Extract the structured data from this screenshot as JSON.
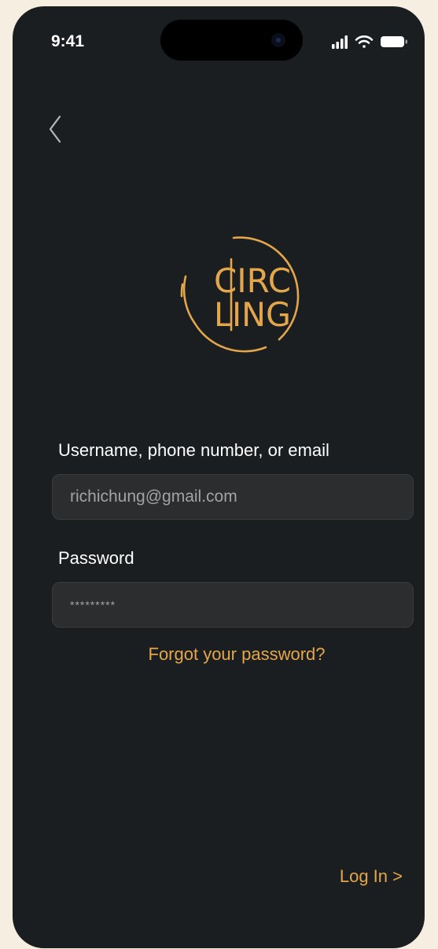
{
  "status_bar": {
    "time": "9:41",
    "icons": [
      "signal-icon",
      "wifi-icon",
      "battery-icon"
    ]
  },
  "nav": {
    "back_icon": "chevron-left-icon"
  },
  "logo": {
    "line1": "CIRC",
    "line2": "LING",
    "color": "#e4a64a"
  },
  "form": {
    "username": {
      "label": "Username, phone number, or email",
      "value": "richichung@gmail.com"
    },
    "password": {
      "label": "Password",
      "value": "*********"
    },
    "forgot_label": "Forgot your password?",
    "login_label": "Log In >"
  },
  "colors": {
    "background": "#1a1e21",
    "accent": "#e4a64a",
    "outer": "#f6efe1"
  }
}
